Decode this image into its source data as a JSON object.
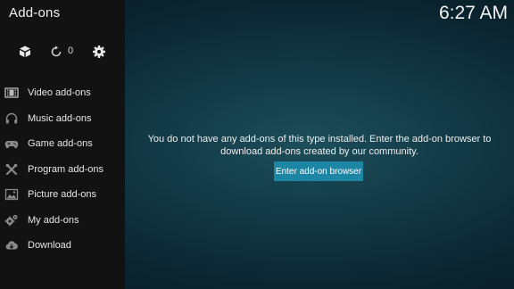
{
  "header": {
    "title": "Add-ons",
    "clock": "6:27 AM"
  },
  "toolbar": {
    "icons": [
      "addon-box-icon",
      "refresh-icon",
      "gear-icon"
    ],
    "update_count": "0"
  },
  "sidebar": {
    "items": [
      {
        "label": "Video add-ons",
        "icon": "film-icon"
      },
      {
        "label": "Music add-ons",
        "icon": "headphones-icon"
      },
      {
        "label": "Game add-ons",
        "icon": "gamepad-icon"
      },
      {
        "label": "Program add-ons",
        "icon": "tools-icon"
      },
      {
        "label": "Picture add-ons",
        "icon": "picture-icon"
      },
      {
        "label": "My add-ons",
        "icon": "gears-icon"
      },
      {
        "label": "Download",
        "icon": "cloud-download-icon"
      }
    ]
  },
  "main": {
    "message": "You do not have any add-ons of this type installed. Enter the add-on browser to download add-ons created by our community.",
    "button_label": "Enter add-on browser"
  },
  "colors": {
    "sidebar_bg": "#121212",
    "button_bg": "#1d86a5",
    "text": "#ffffff"
  }
}
